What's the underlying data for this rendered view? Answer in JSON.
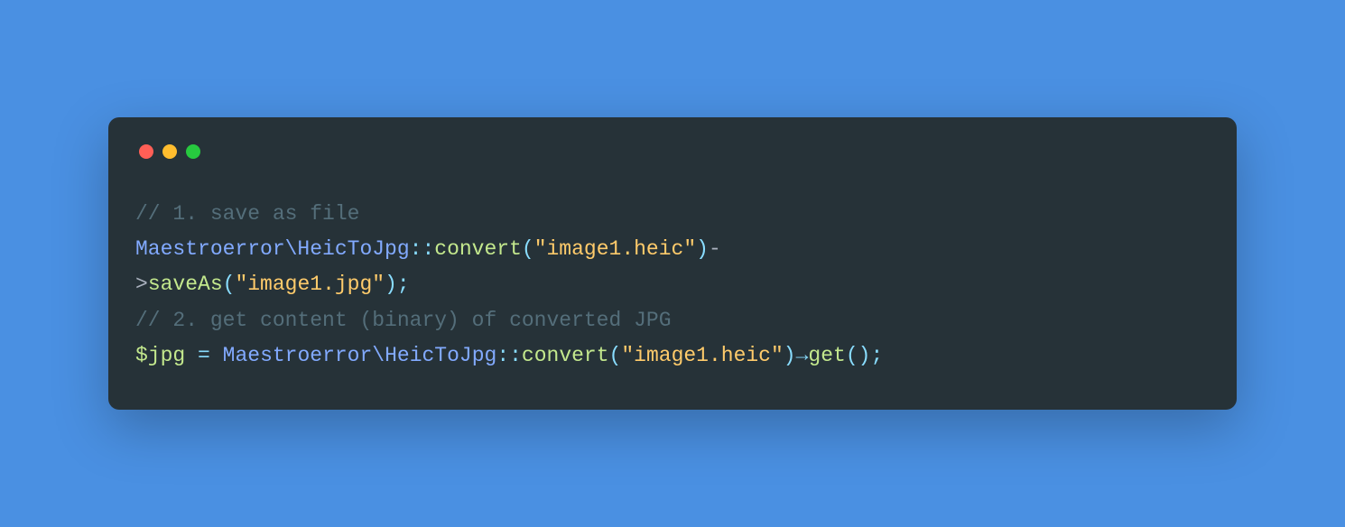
{
  "code": {
    "line1_comment": "// 1. save as file",
    "line2_ns": "Maestroerror\\HeicToJpg",
    "line2_dbl_colon": "::",
    "line2_func": "convert",
    "line2_open_paren": "(",
    "line2_str": "\"image1.heic\"",
    "line2_close_paren": ")",
    "line2_dash": "-",
    "line3_gt": ">",
    "line3_func": "saveAs",
    "line3_open_paren": "(",
    "line3_str": "\"image1.jpg\"",
    "line3_close_paren": ")",
    "line3_semi": ";",
    "line4_comment": "// 2. get content (binary) of converted JPG",
    "line5_var": "$jpg",
    "line5_space1": " ",
    "line5_eq": "=",
    "line5_space2": " ",
    "line5_ns": "Maestroerror\\HeicToJpg",
    "line5_dbl_colon": "::",
    "line5_func1": "convert",
    "line5_open_paren1": "(",
    "line5_str": "\"image1.heic\"",
    "line5_close_paren1": ")",
    "line5_arrow": "→",
    "line5_func2": "get",
    "line5_open_paren2": "(",
    "line5_close_paren2": ")",
    "line5_semi": ";"
  }
}
